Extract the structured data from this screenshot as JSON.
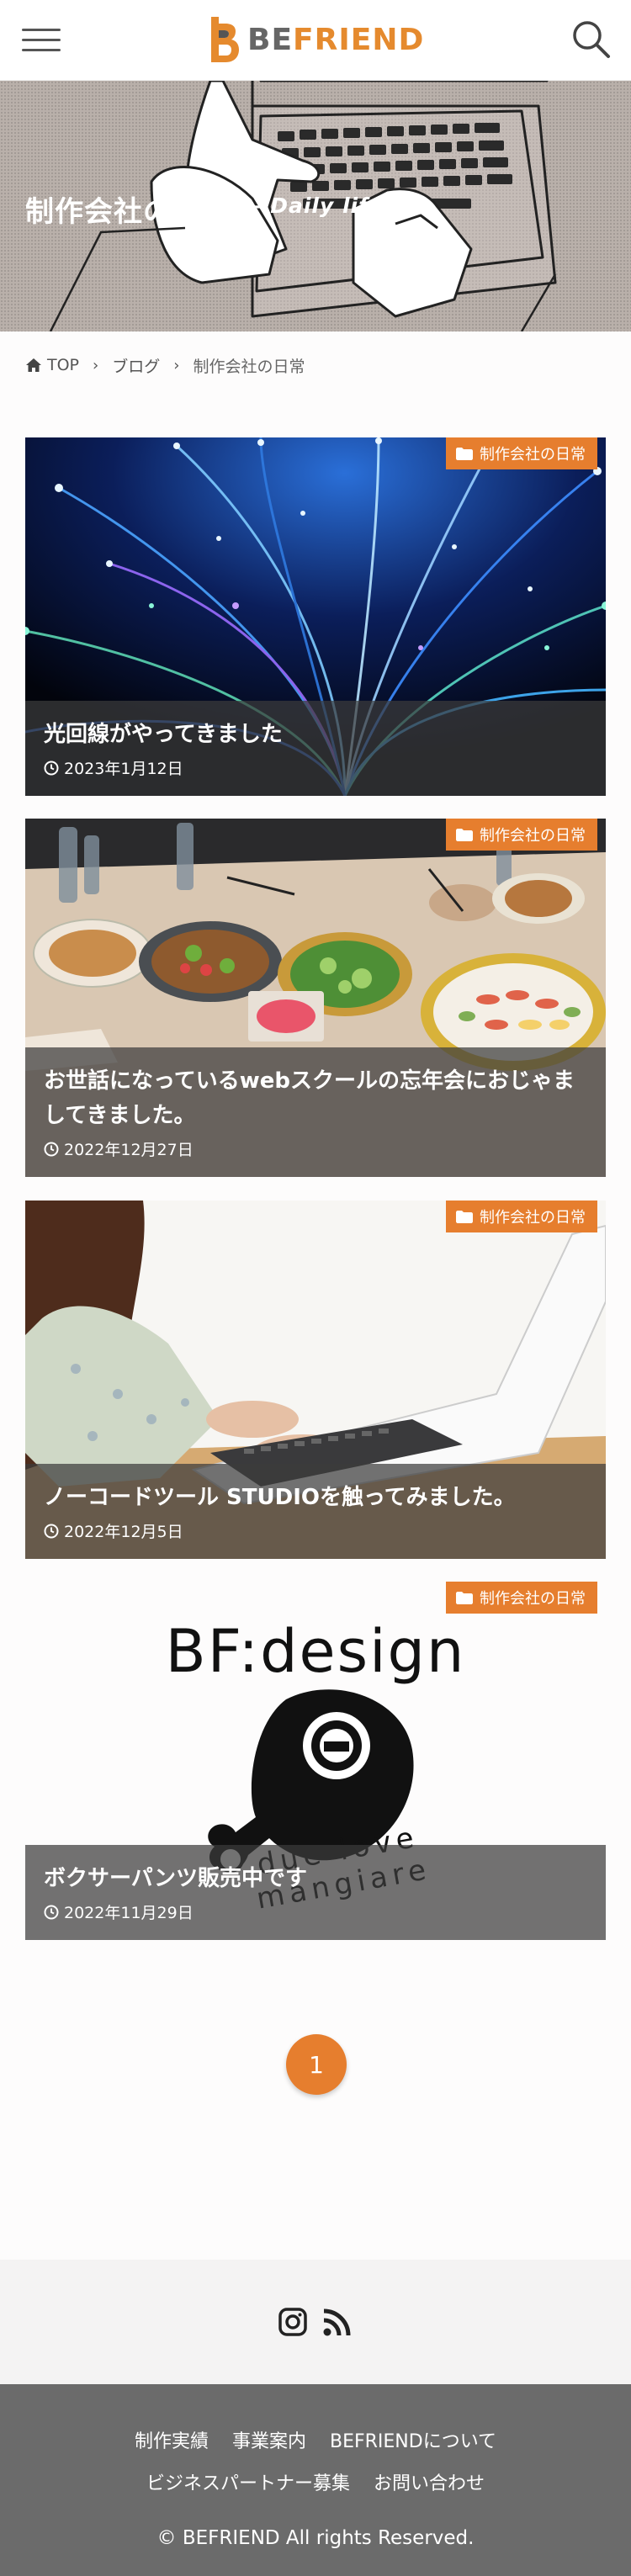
{
  "header": {
    "logo_be": "BE",
    "logo_friend": "FRIEND",
    "colors": {
      "accent": "#e58a2e",
      "logo_gray": "#666666"
    }
  },
  "hero": {
    "title": "制作会社の日常",
    "subtitle": "– Daily life –"
  },
  "breadcrumb": {
    "items": [
      "TOP",
      "ブログ",
      "制作会社の日常"
    ]
  },
  "posts": [
    {
      "category": "制作会社の日常",
      "title": "光回線がやってきました",
      "date": "2023年1月12日",
      "image": "fiber-optic-lights"
    },
    {
      "category": "制作会社の日常",
      "title": "お世話になっているwebスクールの忘年会におじゃましてきました。",
      "date": "2022年12月27日",
      "image": "party-food-table"
    },
    {
      "category": "制作会社の日常",
      "title": "ノーコードツール STUDIOを触ってみました。",
      "date": "2022年12月5日",
      "image": "typing-laptop"
    },
    {
      "category": "制作会社の日常",
      "title": "ボクサーパンツ販売中です",
      "date": "2022年11月29日",
      "image": "bf-design-logo",
      "logo_text": "BF:design",
      "logo_tagline": "due love mangiare"
    }
  ],
  "pagination": {
    "current": "1"
  },
  "social": {
    "icons": [
      "instagram-icon",
      "rss-icon"
    ]
  },
  "footer": {
    "links_row1": [
      "制作実績",
      "事業案内",
      "BEFRIENDについて"
    ],
    "links_row2": [
      "ビジネスパートナー募集",
      "お問い合わせ"
    ],
    "copyright": "© BEFRIEND All rights Reserved."
  }
}
